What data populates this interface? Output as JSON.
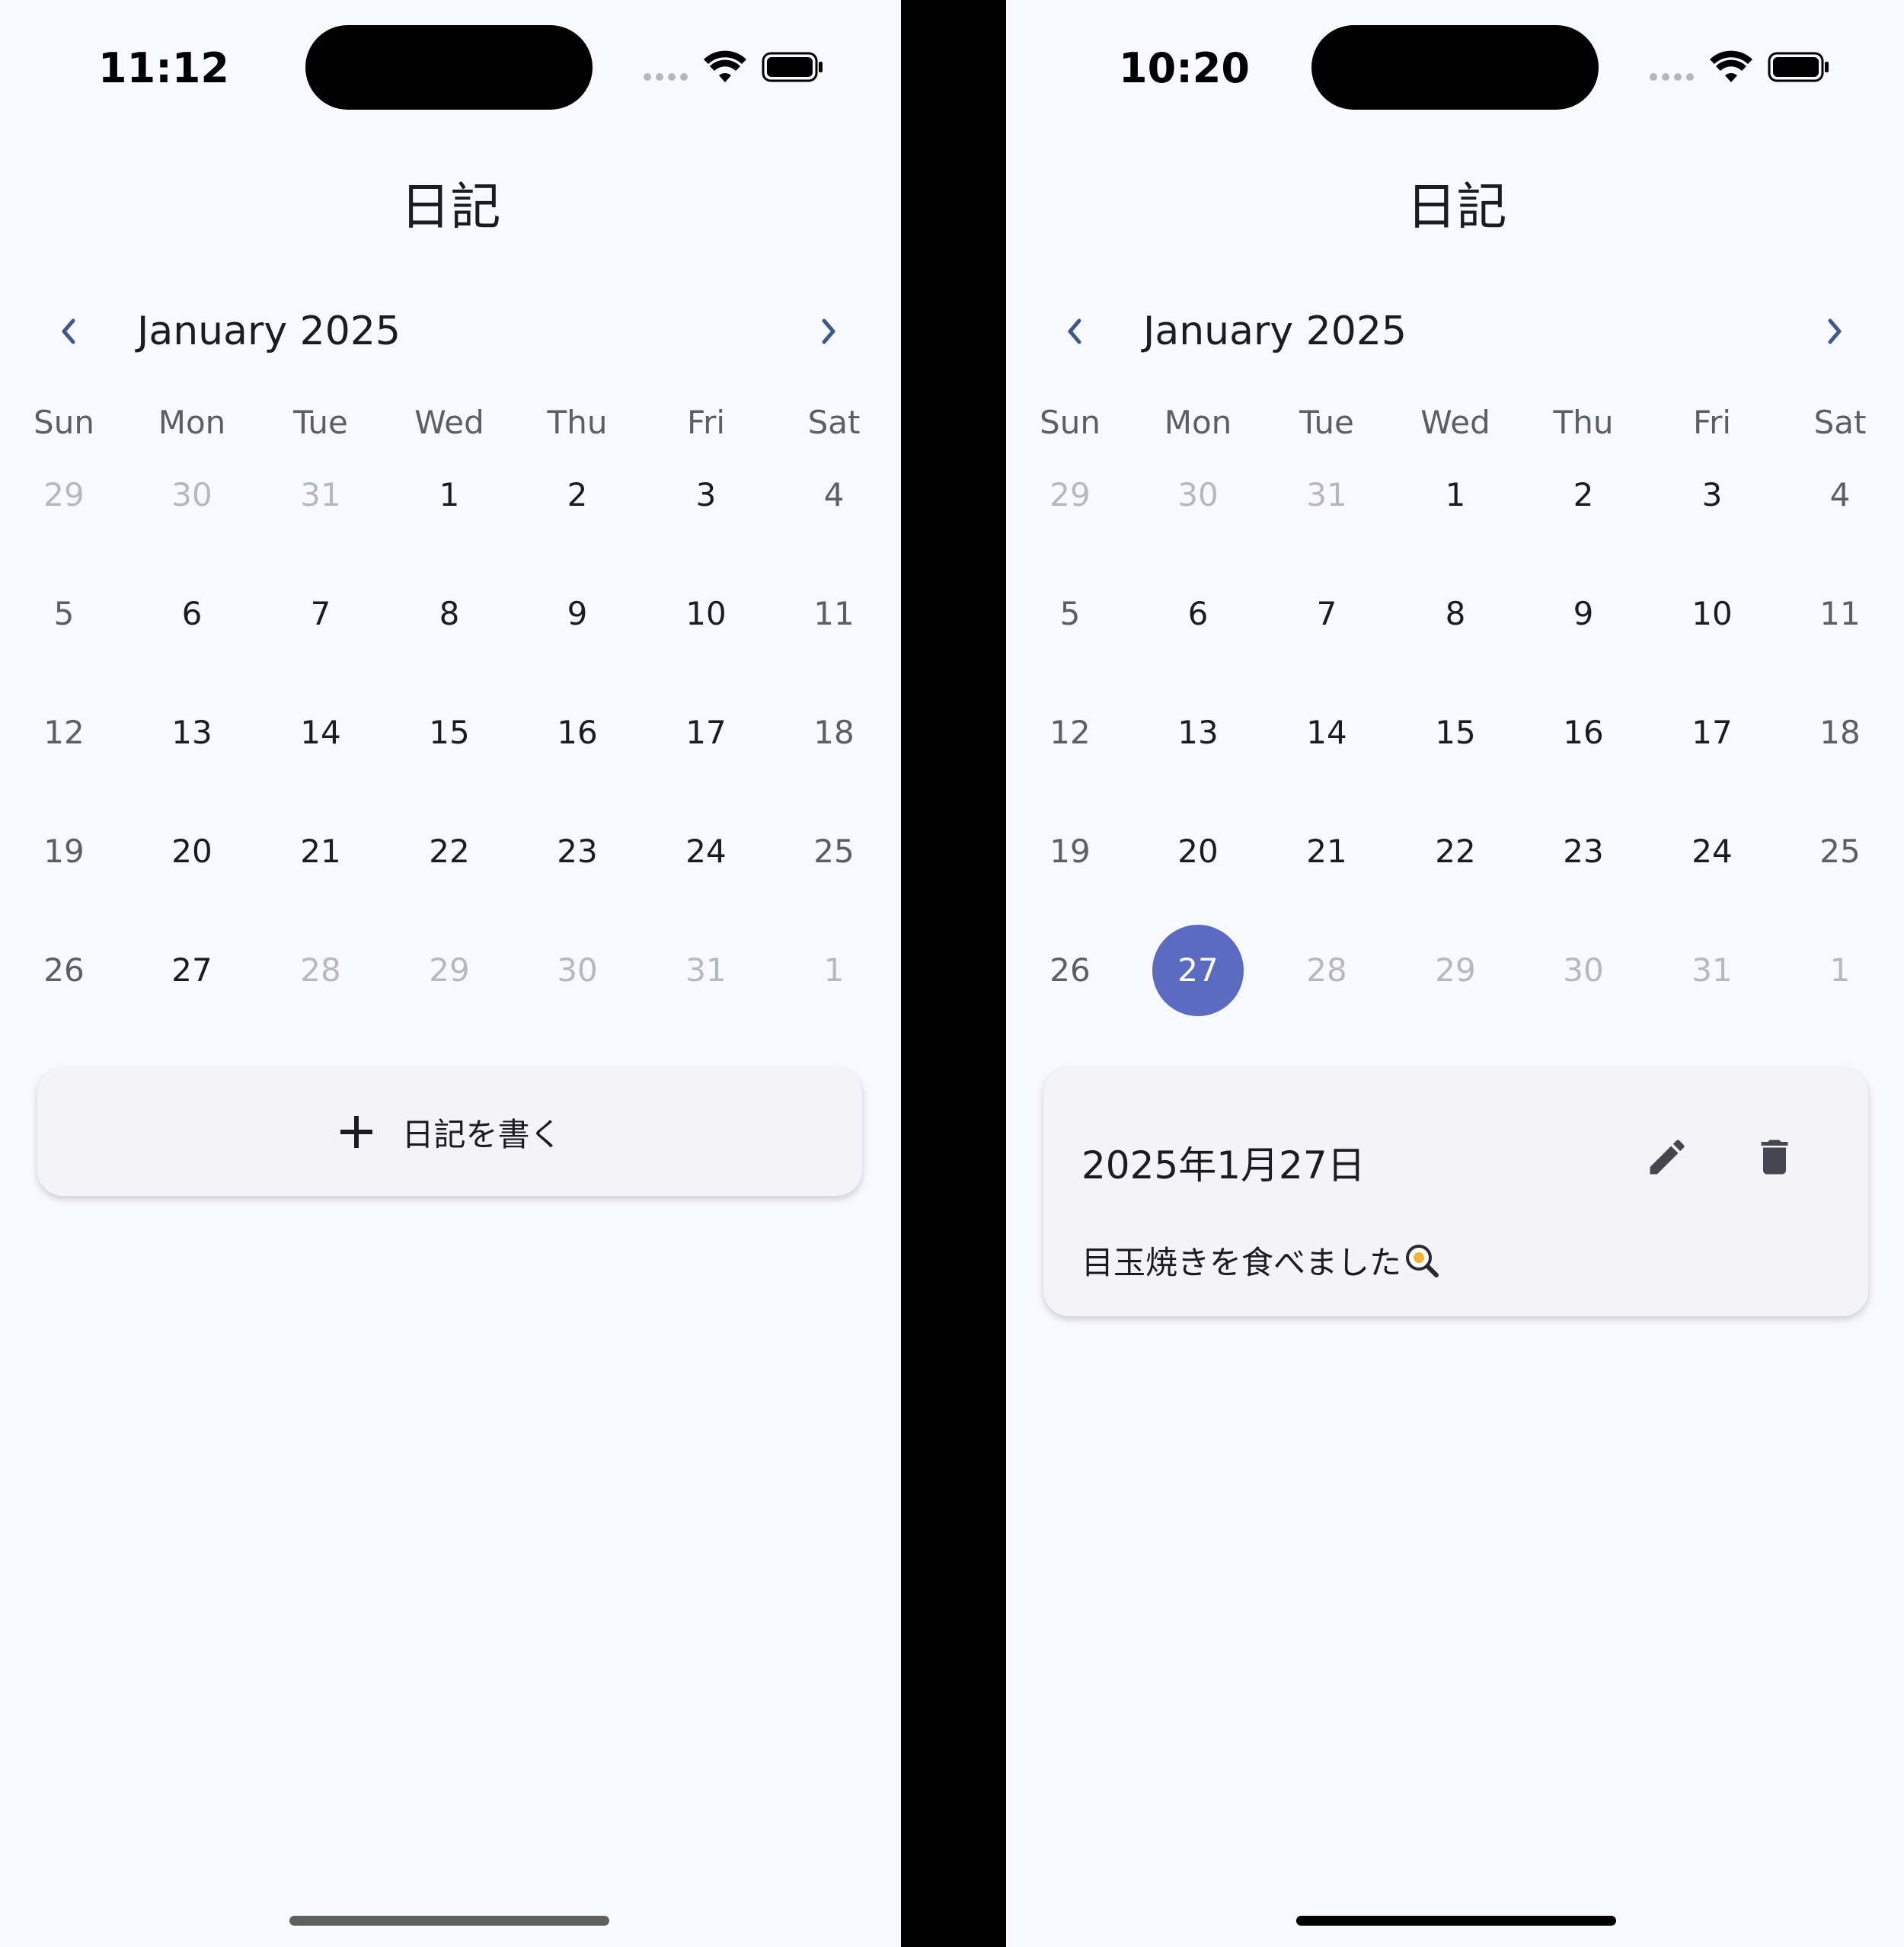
{
  "colors": {
    "background": "#f8f9ff",
    "accent": "#5c6bc0",
    "nav_arrow": "#3f5a8a",
    "text": "#1b1c21",
    "muted": "#b7b8bf"
  },
  "weekdays": [
    "Sun",
    "Mon",
    "Tue",
    "Wed",
    "Thu",
    "Fri",
    "Sat"
  ],
  "calendar_days": [
    [
      "29",
      "30",
      "31",
      "1",
      "2",
      "3",
      "4"
    ],
    [
      "5",
      "6",
      "7",
      "8",
      "9",
      "10",
      "11"
    ],
    [
      "12",
      "13",
      "14",
      "15",
      "16",
      "17",
      "18"
    ],
    [
      "19",
      "20",
      "21",
      "22",
      "23",
      "24",
      "25"
    ],
    [
      "26",
      "27",
      "28",
      "29",
      "30",
      "31",
      "1"
    ]
  ],
  "left_screen": {
    "status_time": "11:12",
    "app_title": "日記",
    "month_label": "January 2025",
    "prev_icon": "chevron-left-icon",
    "next_icon": "chevron-right-icon",
    "write_button": {
      "icon": "plus-icon",
      "label": "日記を書く"
    }
  },
  "right_screen": {
    "status_time": "10:20",
    "app_title": "日記",
    "month_label": "January 2025",
    "prev_icon": "chevron-left-icon",
    "next_icon": "chevron-right-icon",
    "selected_day": "27",
    "entry": {
      "date": "2025年1月27日",
      "text": "目玉焼きを食べました",
      "emoji_icon": "fried-egg-icon",
      "edit_icon": "pencil-icon",
      "delete_icon": "trash-icon"
    }
  }
}
